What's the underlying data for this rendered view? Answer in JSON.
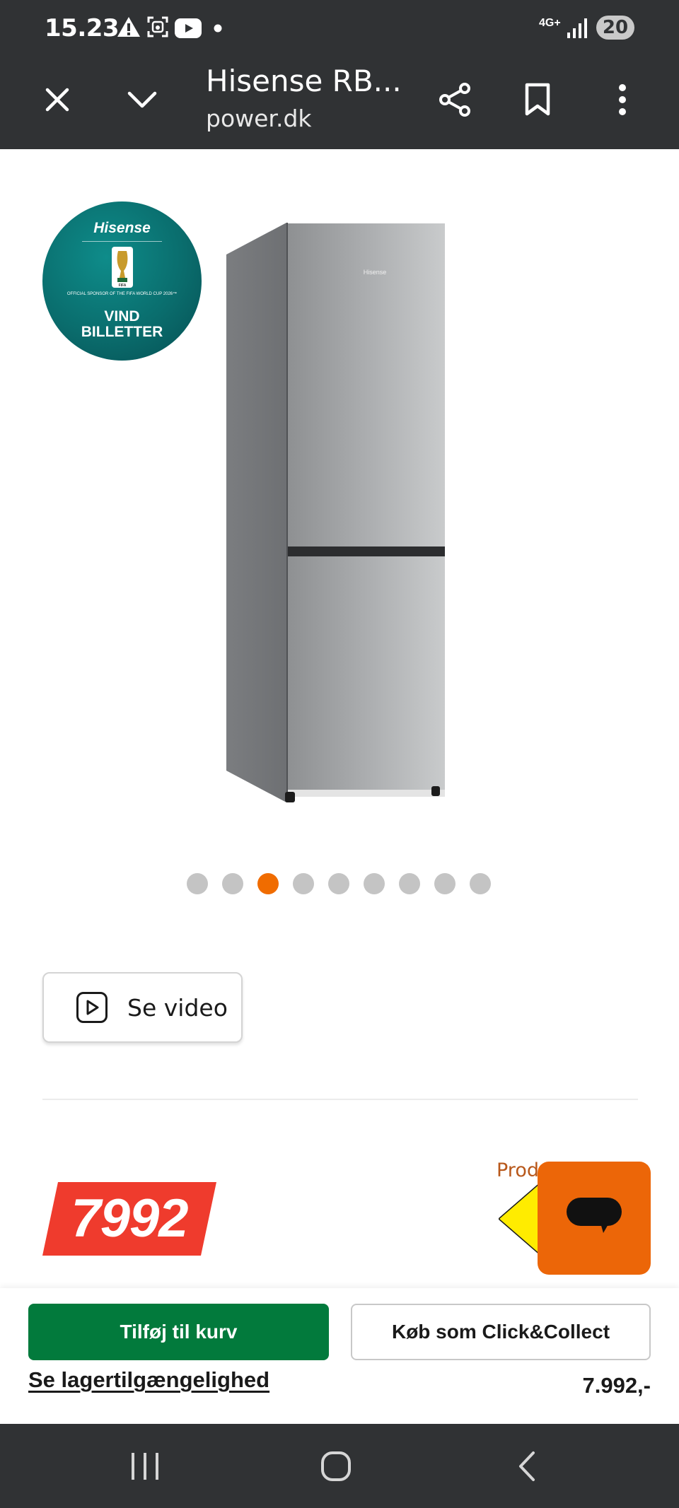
{
  "status_bar": {
    "time": "15.23",
    "network": "4G+",
    "battery": "20",
    "icons": [
      "warning-icon",
      "screenshot-icon",
      "youtube-icon",
      "dot-icon",
      "signal-icon"
    ]
  },
  "browser": {
    "page_title": "Hisense RB...",
    "url": "power.dk",
    "icons": [
      "close-icon",
      "chevron-down-icon",
      "share-icon",
      "bookmark-icon",
      "more-vert-icon"
    ]
  },
  "badge": {
    "brand": "Hisense",
    "sponsor_text": "OFFICIAL SPONSOR OF THE FIFA WORLD CUP 2026™",
    "cta_line1": "VIND",
    "cta_line2": "BILLETTER"
  },
  "product": {
    "image_brand": "Hisense"
  },
  "carousel": {
    "total": 9,
    "active_index": 2
  },
  "video": {
    "label": "Se video"
  },
  "price": {
    "value": "7992",
    "product_label_partial": "Produ",
    "colors": {
      "tag": "#ef3b2d",
      "label": "#b8581b"
    }
  },
  "chat": {
    "icon": "chat-bubble-icon",
    "color": "#ec6608"
  },
  "buy_bar": {
    "add_to_cart": "Tilføj til kurv",
    "click_collect": "Køb som Click&Collect",
    "stock_link": "Se lagertilgængelighed",
    "price": "7.992,-",
    "colors": {
      "primary": "#027a3c"
    }
  },
  "nav": {
    "icons": [
      "recent-apps-icon",
      "home-icon",
      "back-icon"
    ]
  }
}
